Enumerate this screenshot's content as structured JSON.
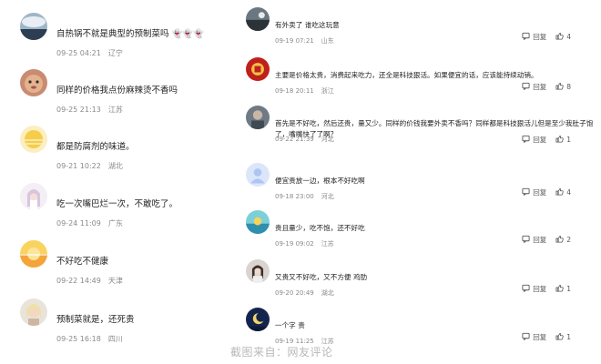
{
  "left_comments": [
    {
      "text": "自热锅不就是典型的预制菜吗 👻👻👻",
      "date": "09-25 04:21",
      "location": "辽宁"
    },
    {
      "text": "同样的价格我点份麻辣烫不香吗",
      "date": "09-25 21:13",
      "location": "江苏"
    },
    {
      "text": "都是防腐剂的味道。",
      "date": "09-21 10:22",
      "location": "湖北"
    },
    {
      "text": "吃一次嘴巴烂一次，不敢吃了。",
      "date": "09-24 11:09",
      "location": "广东"
    },
    {
      "text": "不好吃不健康",
      "date": "09-22 14:49",
      "location": "天津"
    },
    {
      "text": "预制菜就是，还死贵",
      "date": "09-25 16:18",
      "location": "四川"
    }
  ],
  "right_comments": [
    {
      "text": "有外卖了 谁吃这玩意",
      "date": "09-19 07:21",
      "location": "山东",
      "reply_label": "回复",
      "likes": "4"
    },
    {
      "text": "主要是价格太贵，消费起来吃力，还全是科技狠活。如果便宜的话，应该能持续动销。",
      "date": "09-18 20:11",
      "location": "浙江",
      "reply_label": "回复",
      "likes": "8"
    },
    {
      "text": "首先是不好吃，然后还贵，量又少。同样的价钱我要外卖不香吗？同样都是科技狠活儿但是至少我肚子饱了，嘴嘴快了了啊？",
      "date": "09-22 21:39",
      "location": "河北",
      "reply_label": "回复",
      "likes": "1"
    },
    {
      "text": "便宜贵放一边，根本不好吃啊",
      "date": "09-18 23:00",
      "location": "河北",
      "reply_label": "回复",
      "likes": "4"
    },
    {
      "text": "贵且量少，吃不饱，还不好吃",
      "date": "09-19 09:02",
      "location": "江苏",
      "reply_label": "回复",
      "likes": "2"
    },
    {
      "text": "又贵又不好吃，又不方便 鸡肋",
      "date": "09-20 20:49",
      "location": "湖北",
      "reply_label": "回复",
      "likes": "1"
    },
    {
      "text": "一个字 贵",
      "date": "09-19 11:25",
      "location": "江苏",
      "reply_label": "回复",
      "likes": "1"
    }
  ],
  "caption": "截图来自：网友评论"
}
